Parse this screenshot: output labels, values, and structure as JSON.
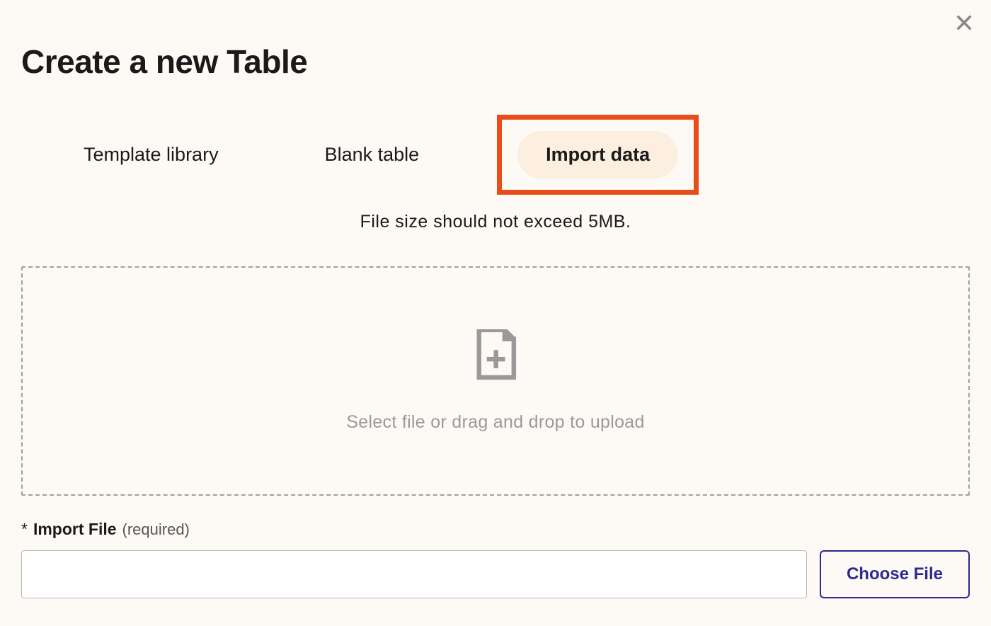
{
  "modal": {
    "title": "Create a new Table"
  },
  "tabs": {
    "items": [
      {
        "label": "Template library",
        "active": false,
        "highlighted": false
      },
      {
        "label": "Blank table",
        "active": false,
        "highlighted": false
      },
      {
        "label": "Import data",
        "active": true,
        "highlighted": true
      }
    ]
  },
  "hint": "File size should not exceed 5MB.",
  "dropzone": {
    "text": "Select file or drag and drop to upload"
  },
  "field": {
    "asterisk": "*",
    "label": "Import File",
    "required": "(required)",
    "value": "",
    "button": "Choose File"
  },
  "colors": {
    "background": "#fdfaf5",
    "highlight": "#e84c18",
    "tabActiveBg": "#fcefe0",
    "accent": "#2b2b8f",
    "mutedText": "#9a9a9a"
  }
}
